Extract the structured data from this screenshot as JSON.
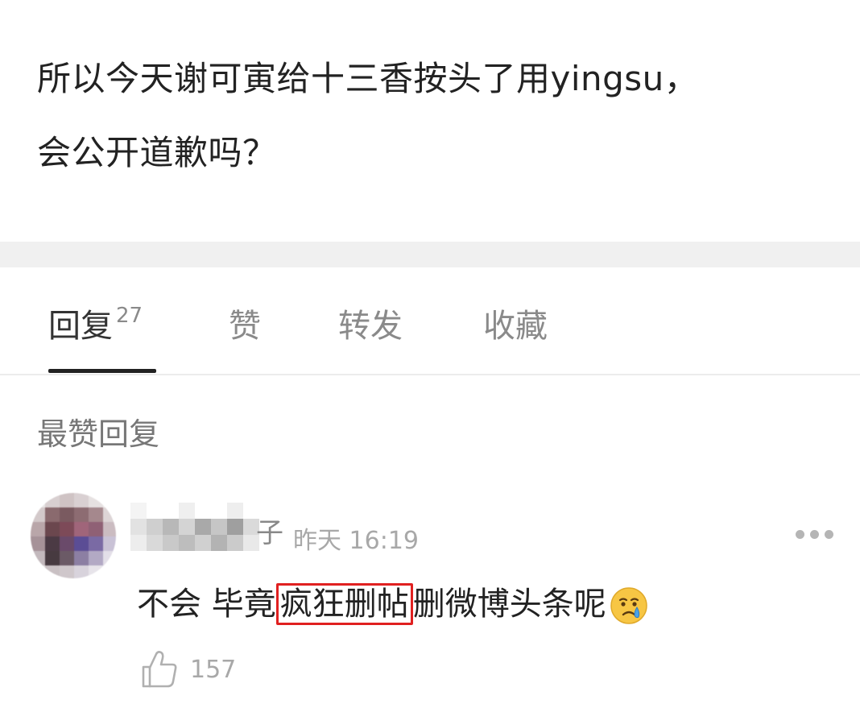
{
  "post": {
    "line1": "所以今天谢可寅给十三香按头了用yingsu，",
    "line2": "会公开道歉吗？"
  },
  "tabs": {
    "reply_label": "回复",
    "reply_count": "27",
    "like_label": "赞",
    "repost_label": "转发",
    "favorite_label": "收藏"
  },
  "section": {
    "title": "最赞回复"
  },
  "comment": {
    "username_tail": "子",
    "timestamp": "昨天 16:19",
    "text_before": "不会 毕竟",
    "text_highlight": "疯狂删帖",
    "text_after": "删微博头条呢",
    "emoji": "crying-face-emoji",
    "like_count": "157"
  },
  "colors": {
    "highlight_border": "#e02020",
    "tab_active": "#333333",
    "tab_inactive": "#8a8a8a",
    "muted_text": "#a8a8a8",
    "separator_band": "#f0f0f0"
  },
  "icons": {
    "more": "more-dots-icon",
    "like": "thumbs-up-icon"
  }
}
